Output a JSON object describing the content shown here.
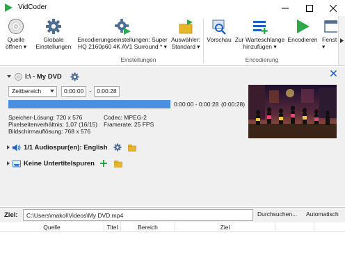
{
  "window": {
    "title": "VidCoder",
    "icons": {
      "app": "vidcoder-play-logo",
      "minimize": "minimize-icon",
      "maximize": "maximize-icon",
      "close": "close-icon"
    }
  },
  "ribbon": {
    "source_btn": {
      "line1": "Quelle",
      "line2": "öffnen ▾",
      "icon": "disc-icon"
    },
    "global_settings_btn": {
      "line1": "Globale",
      "line2": "Einstellungen",
      "icon": "gear-icon"
    },
    "encoding_settings_btn": {
      "line1": "Encodierungseinstellungen: Super",
      "line2": "HQ 2160p60 4K AV1 Surround * ▾",
      "icon": "encoding-gear-icon"
    },
    "picker_btn": {
      "line1": "Auswähler:",
      "line2": "Standard ▾",
      "icon": "picker-folder-icon"
    },
    "group_settings_label": "Einstellungen",
    "preview_btn": {
      "line1": "Vorschau",
      "icon": "preview-magnifier-icon"
    },
    "queue_btn": {
      "line1": "Zur Warteschlange",
      "line2": "hinzufügen ▾",
      "icon": "queue-add-icon"
    },
    "encode_btn": {
      "line1": "Encodieren",
      "icon": "play-icon"
    },
    "window_btn": {
      "line1": "Fenst",
      "line2": "▾",
      "icon": "window-icon"
    },
    "group_encoding_label": "Encodierung"
  },
  "source": {
    "title": "I:\\ - My DVD",
    "icons": {
      "collapse": "chevron-down-icon",
      "disc": "disc-icon",
      "settings": "gear-icon",
      "close": "close-icon"
    },
    "range_type": "Zeitbereich",
    "start_time": "0:00:00",
    "range_sep": "-",
    "end_time": "0:00:28",
    "progress_fraction": 1.0,
    "range_text": "0:00:00 - 0:00:28",
    "duration_text": "(0:00:28)",
    "info": {
      "storage_res": "Speicher-Lösung: 720 x 576",
      "pixel_aspect": "Pixelseitenverhältnis: 1,07 (16/15)",
      "display_res": "Bildschirmauflösung: 768 x 576",
      "codec": "Codec: MPEG-2",
      "framerate": "Framerate: 25  FPS"
    },
    "audio": {
      "label": "1/1 Audiospur(en): English",
      "icons": [
        "chevron-right-icon",
        "speaker-icon",
        "gear-icon",
        "folder-icon"
      ]
    },
    "subtitles": {
      "label": "Keine Untertitelspuren",
      "icons": [
        "chevron-right-icon",
        "subtitle-icon",
        "plus-icon",
        "folder-icon"
      ]
    }
  },
  "destination": {
    "label": "Ziel:",
    "path": "C:\\Users\\makol\\Videos\\My DVD.mp4",
    "browse_label": "Durchsuchen...",
    "auto_label": "Automatisch"
  },
  "queue": {
    "columns": [
      "Quelle",
      "Titel",
      "Bereich",
      "Ziel"
    ]
  },
  "colors": {
    "accent_blue": "#4a8fe0",
    "play_green": "#2aa84a",
    "panel_bg": "#f0f0f0",
    "folder_yellow": "#e8b62a"
  }
}
